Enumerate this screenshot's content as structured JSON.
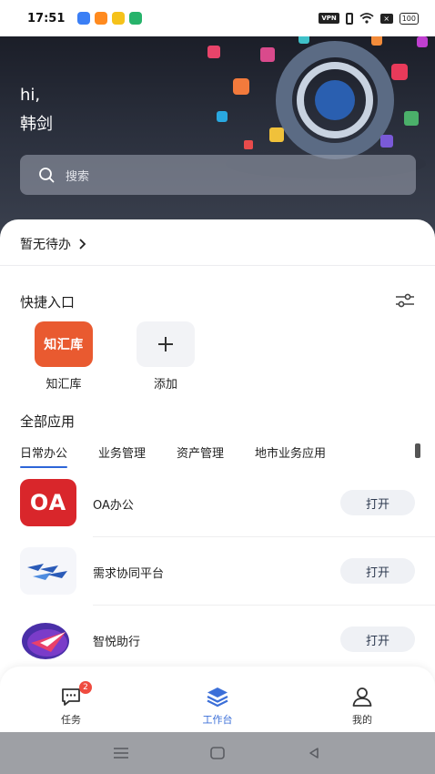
{
  "status_bar": {
    "time": "17:51",
    "notification_colors": [
      "#3b7ff5",
      "#ff8a1f",
      "#f5c21b",
      "#27b36b"
    ],
    "vpn": "VPN",
    "battery": "100"
  },
  "header": {
    "greeting": "hi,",
    "user_name": "韩剑",
    "search_placeholder": "搜索"
  },
  "todo": {
    "label": "暂无待办"
  },
  "quick_entry": {
    "title": "快捷入口",
    "items": [
      {
        "label": "知汇库",
        "tile_text": "知汇库"
      },
      {
        "label": "添加"
      }
    ]
  },
  "all_apps": {
    "title": "全部应用",
    "tabs": [
      "日常办公",
      "业务管理",
      "资产管理",
      "地市业务应用"
    ],
    "active_tab": 0,
    "apps": [
      {
        "name": "OA办公",
        "icon_text": "OA",
        "action": "打开"
      },
      {
        "name": "需求协同平台",
        "action": "打开"
      },
      {
        "name": "智悦助行",
        "action": "打开"
      }
    ]
  },
  "bottom_nav": {
    "items": [
      {
        "label": "任务",
        "badge": "2"
      },
      {
        "label": "工作台"
      },
      {
        "label": "我的"
      }
    ],
    "active": 1
  },
  "colors": {
    "accent": "#3b6fd8",
    "oa_red": "#d9262b",
    "quick_orange": "#e95a30",
    "badge_red": "#ef4b3f"
  }
}
